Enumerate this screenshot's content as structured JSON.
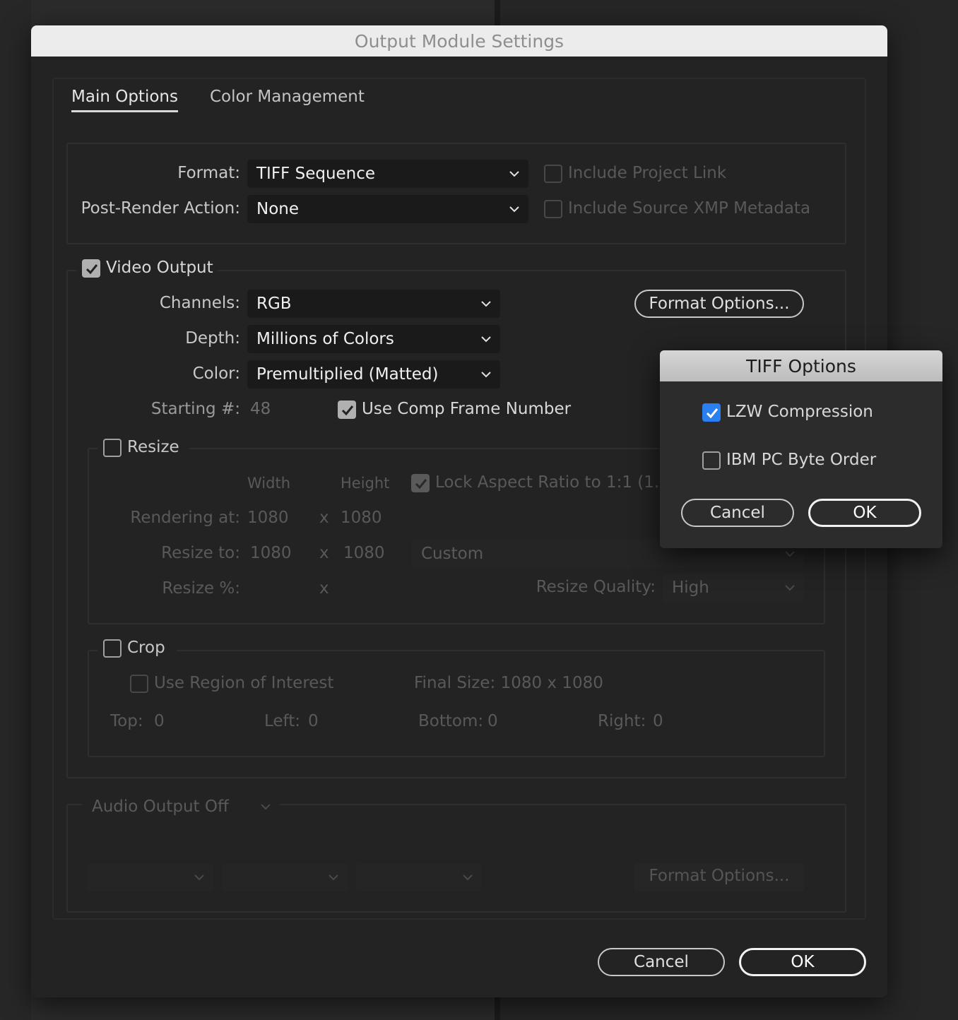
{
  "dialog": {
    "title": "Output Module Settings"
  },
  "tabs": {
    "main": "Main Options",
    "color": "Color Management"
  },
  "format": {
    "format_label": "Format:",
    "format_value": "TIFF Sequence",
    "post_render_label": "Post-Render Action:",
    "post_render_value": "None",
    "include_project_link": "Include Project Link",
    "include_xmp": "Include Source XMP Metadata"
  },
  "video": {
    "section_label": "Video Output",
    "channels_label": "Channels:",
    "channels_value": "RGB",
    "depth_label": "Depth:",
    "depth_value": "Millions of Colors",
    "color_label": "Color:",
    "color_value": "Premultiplied (Matted)",
    "starting_label": "Starting #:",
    "starting_value": "48",
    "use_comp_frame": "Use Comp Frame Number",
    "format_options": "Format Options..."
  },
  "resize": {
    "section_label": "Resize",
    "width_header": "Width",
    "height_header": "Height",
    "lock_aspect": "Lock Aspect Ratio to 1:1 (1.00",
    "rendering_label": "Rendering at:",
    "rendering_w": "1080",
    "rendering_h": "1080",
    "resize_to_label": "Resize to:",
    "resize_w": "1080",
    "resize_h": "1080",
    "preset_value": "Custom",
    "percent_label": "Resize %:",
    "x": "x",
    "quality_label": "Resize Quality:",
    "quality_value": "High"
  },
  "crop": {
    "section_label": "Crop",
    "use_roi": "Use Region of Interest",
    "final_size": "Final Size: 1080 x 1080",
    "top_label": "Top:",
    "top_value": "0",
    "left_label": "Left:",
    "left_value": "0",
    "bottom_label": "Bottom:",
    "bottom_value": "0",
    "right_label": "Right:",
    "right_value": "0"
  },
  "audio": {
    "section_label": "Audio Output Off",
    "format_options": "Format Options..."
  },
  "footer": {
    "cancel": "Cancel",
    "ok": "OK"
  },
  "tiff_options": {
    "title": "TIFF Options",
    "lzw": "LZW Compression",
    "lzw_checked": true,
    "ibm": "IBM PC Byte Order",
    "ibm_checked": false,
    "cancel": "Cancel",
    "ok": "OK"
  }
}
